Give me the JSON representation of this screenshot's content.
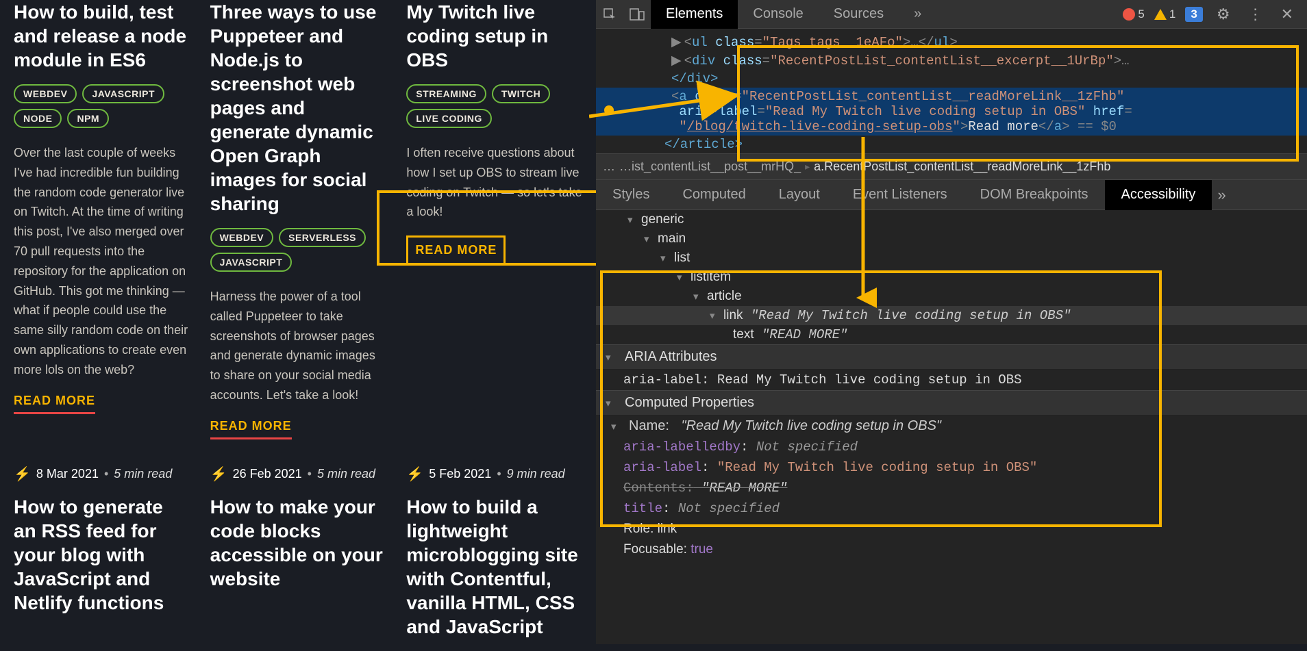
{
  "blog": {
    "row1": [
      {
        "title": "How to build, test and release a node module in ES6",
        "tags": [
          "WEBDEV",
          "JAVASCRIPT",
          "NODE",
          "NPM"
        ],
        "excerpt": "Over the last couple of weeks I've had incredible fun building the random code generator live on Twitch. At the time of writing this post, I've also merged over 70 pull requests into the repository for the application on GitHub. This got me thinking — what if people could use the same silly random code on their own applications to create even more lols on the web?",
        "readmore": "READ MORE"
      },
      {
        "title": "Three ways to use Puppeteer and Node.js to screenshot web pages and generate dynamic Open Graph images for social sharing",
        "tags": [
          "WEBDEV",
          "SERVERLESS",
          "JAVASCRIPT"
        ],
        "excerpt": "Harness the power of a tool called Puppeteer to take screenshots of browser pages and generate dynamic images to share on your social media accounts. Let's take a look!",
        "readmore": "READ MORE"
      },
      {
        "title": "My Twitch live coding setup in OBS",
        "tags": [
          "STREAMING",
          "TWITCH",
          "LIVE CODING"
        ],
        "excerpt": "I often receive questions about how I set up OBS to stream live coding on Twitch — so let's take a look!",
        "readmore": "READ MORE"
      }
    ],
    "row2": [
      {
        "date": "8 Mar 2021",
        "mins": "5 min read",
        "title": "How to generate an RSS feed for your blog with JavaScript and Netlify functions"
      },
      {
        "date": "26 Feb 2021",
        "mins": "5 min read",
        "title": "How to make your code blocks accessible on your website"
      },
      {
        "date": "5 Feb 2021",
        "mins": "9 min read",
        "title": "How to build a lightweight microblogging site with Contentful, vanilla HTML, CSS and JavaScript"
      }
    ]
  },
  "devtools": {
    "tabs": {
      "elements": "Elements",
      "console": "Console",
      "sources": "Sources"
    },
    "badges": {
      "errors": "5",
      "warnings": "1",
      "info": "3"
    },
    "dom": {
      "ul_class": "Tags_tags__1eAFo",
      "div_close": "</div>",
      "excerpt_class": "RecentPostList_contentList__excerpt__1UrBp",
      "a_class": "RecentPostList_contentList__readMoreLink__1zFhb",
      "aria_label": "Read My Twitch live coding setup in OBS",
      "href": "/blog/twitch-live-coding-setup-obs",
      "a_text": "Read more",
      "eq0": "== $0",
      "article_close": "</article>"
    },
    "breadcrumb": {
      "first": "…ist_contentList__post__mrHQ_",
      "last": "a.RecentPostList_contentList__readMoreLink__1zFhb"
    },
    "subtabs": {
      "styles": "Styles",
      "computed": "Computed",
      "layout": "Layout",
      "events": "Event Listeners",
      "dom": "DOM Breakpoints",
      "a11y": "Accessibility"
    },
    "tree": {
      "generic": "generic",
      "main": "main",
      "list": "list",
      "listitem": "listitem",
      "article": "article",
      "link_label": "link",
      "link_name": "\"Read My Twitch live coding setup in OBS\"",
      "text_label": "text",
      "text_name": "\"READ MORE\""
    },
    "aria_section": "ARIA Attributes",
    "aria_attr_key": "aria-label",
    "aria_attr_val": "Read My Twitch live coding setup in OBS",
    "computed_section": "Computed Properties",
    "name_label": "Name:",
    "name_value": "\"Read My Twitch live coding setup in OBS\"",
    "props": {
      "labelledby_key": "aria-labelledby",
      "labelledby_val": "Not specified",
      "arialabel_key": "aria-label",
      "arialabel_val": "\"Read My Twitch live coding setup in OBS\"",
      "contents_key": "Contents:",
      "contents_val": "\"READ MORE\"",
      "title_key": "title",
      "title_val": "Not specified",
      "role_key": "Role:",
      "role_val": "link",
      "focusable_key": "Focusable:",
      "focusable_val": "true"
    }
  }
}
